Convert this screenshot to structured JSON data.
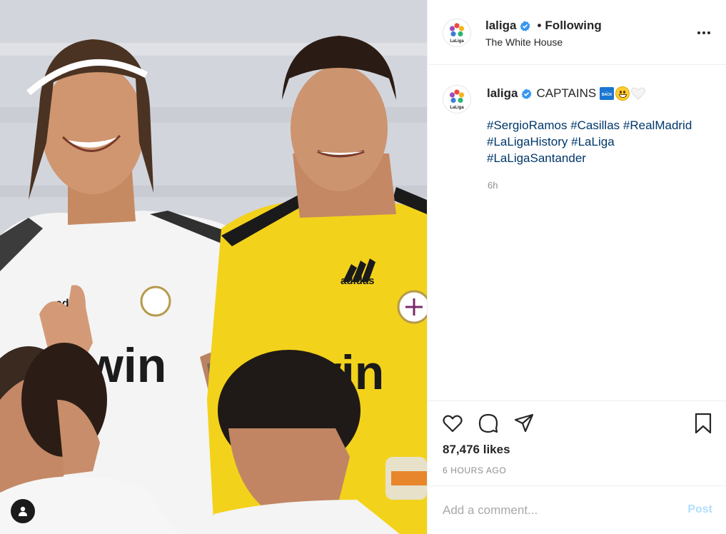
{
  "post": {
    "account": "laliga",
    "verified": true,
    "follow_separator": "•",
    "follow_status": "Following",
    "location": "The White House",
    "logo_text": "LaLiga",
    "caption_text": "CAPTAINS",
    "caption_emojis": [
      "back-arrow-emoji",
      "grinning-emoji",
      "white-heart-emoji"
    ],
    "back_emoji_text": "BACK",
    "hashtags": [
      "#SergioRamos",
      "#Casillas",
      "#RealMadrid",
      "#LaLigaHistory",
      "#LaLiga",
      "#LaLigaSantander"
    ],
    "caption_age": "6h",
    "likes": "87,476 likes",
    "posted_ago": "6 HOURS AGO"
  },
  "photo": {
    "jersey_sponsor_left": "win",
    "jersey_sponsor_right": "win",
    "kit_brand": "adidas"
  },
  "comment": {
    "placeholder": "Add a comment...",
    "post_label": "Post"
  },
  "icons": {
    "like": "heart-outline-icon",
    "comment": "comment-bubble-icon",
    "share": "paper-plane-icon",
    "save": "bookmark-icon",
    "more": "more-options-icon",
    "user_tags": "user-tag-icon"
  },
  "colors": {
    "verified_blue": "#3897f0",
    "hashtag_blue": "#00376b",
    "post_button_disabled": "#b2dffc",
    "secondary_text": "#8e8e8e"
  }
}
